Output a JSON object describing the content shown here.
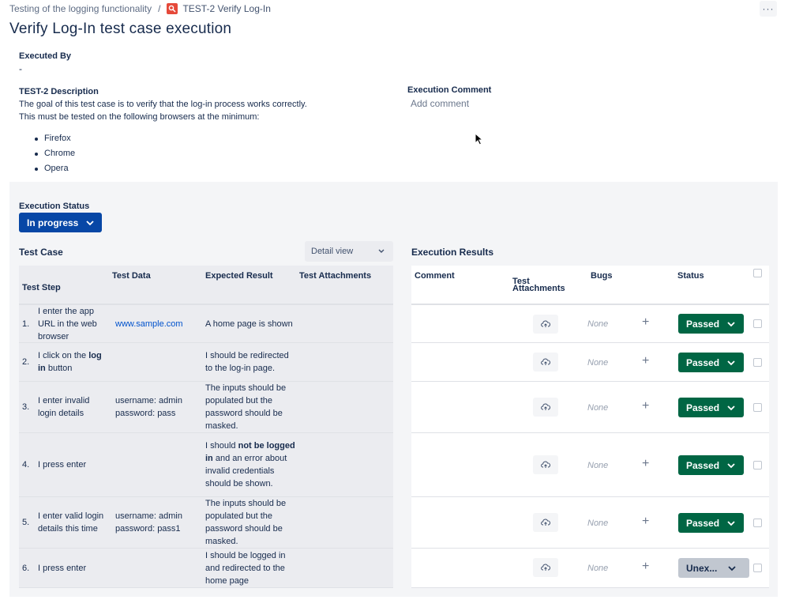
{
  "breadcrumb": {
    "parent": "Testing of the logging functionality",
    "separator": "/",
    "issue_key": "TEST-2",
    "issue_title": "Verify Log-In"
  },
  "more_label": "···",
  "page_title": "Verify Log-In test case execution",
  "executed_by": {
    "label": "Executed By",
    "value": "-"
  },
  "description": {
    "label": "TEST-2 Description",
    "line1": "The goal of this test case is to verify that the log-in process works correctly.",
    "line2": "This must be tested on the following browsers at the minimum:",
    "browsers": [
      "Firefox",
      "Chrome",
      "Opera"
    ]
  },
  "execution_comment": {
    "label": "Execution Comment",
    "placeholder": "Add comment"
  },
  "execution_status": {
    "label": "Execution Status",
    "value": "In progress"
  },
  "test_case": {
    "title": "Test Case",
    "view_select": "Detail view",
    "columns": [
      "Test Step",
      "Test Data",
      "Expected Result",
      "Test Attachments"
    ],
    "rows": [
      {
        "num": "1.",
        "step": "I enter the app URL in the web browser",
        "data": "www.sample.com",
        "expected": "A home page is shown"
      },
      {
        "num": "2.",
        "step_pre": "I click on the ",
        "step_bold": "log in",
        "step_post": " button",
        "data": "",
        "expected": "I should be redirected to the log-in page."
      },
      {
        "num": "3.",
        "step": "I enter invalid login details",
        "data": "username: admin password: pass",
        "expected": "The inputs should be populated but the password should be masked."
      },
      {
        "num": "4.",
        "step": "I press enter",
        "data": "",
        "expected_pre": "I should ",
        "expected_bold": "not be logged in",
        "expected_post": " and an error about invalid credentials should be shown."
      },
      {
        "num": "5.",
        "step": "I enter valid login details this time",
        "data": "username: admin password: pass1",
        "expected": "The inputs should be populated but the password should be masked."
      },
      {
        "num": "6.",
        "step": "I press enter",
        "data": "",
        "expected": "I should be logged in and redirected to the home page"
      }
    ]
  },
  "execution_results": {
    "title": "Execution Results",
    "columns": {
      "comment": "Comment",
      "attachments_1": "Test",
      "attachments_2": "Attachments",
      "bugs": "Bugs",
      "status": "Status"
    },
    "bugs_none": "None",
    "add_label": "+",
    "rows": [
      {
        "status": "Passed"
      },
      {
        "status": "Passed"
      },
      {
        "status": "Passed"
      },
      {
        "status": "Passed"
      },
      {
        "status": "Passed"
      },
      {
        "status": "Unex..."
      }
    ]
  },
  "colors": {
    "primary": "#0747a6",
    "passed": "#006644",
    "unexecuted": "#c1c7d0",
    "link": "#0052cc"
  }
}
